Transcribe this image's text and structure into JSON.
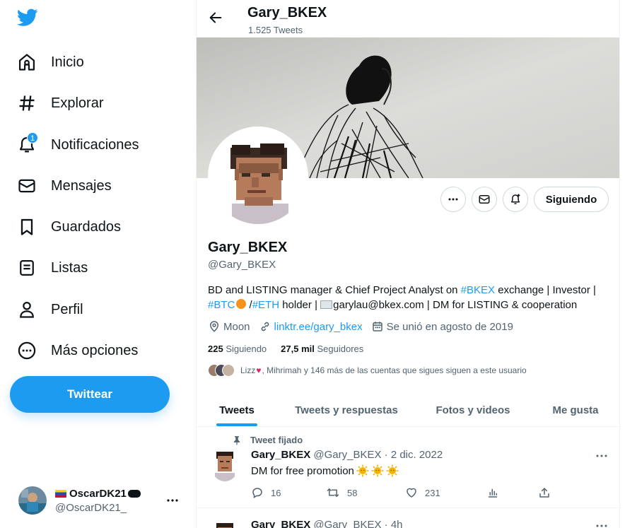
{
  "sidebar": {
    "items": [
      {
        "label": "Inicio",
        "icon": "home-icon"
      },
      {
        "label": "Explorar",
        "icon": "hashtag-icon"
      },
      {
        "label": "Notificaciones",
        "icon": "bell-icon",
        "badge": "1"
      },
      {
        "label": "Mensajes",
        "icon": "mail-icon"
      },
      {
        "label": "Guardados",
        "icon": "bookmark-icon"
      },
      {
        "label": "Listas",
        "icon": "list-icon"
      },
      {
        "label": "Perfil",
        "icon": "person-icon"
      },
      {
        "label": "Más opciones",
        "icon": "more-circle-icon"
      }
    ],
    "tweet_button": "Twittear",
    "account": {
      "name": "OscarDK21",
      "handle": "@OscarDK21_"
    }
  },
  "header": {
    "name": "Gary_BKEX",
    "tweet_count": "1.525 Tweets"
  },
  "profile": {
    "follow_button": "Siguiendo",
    "name": "Gary_BKEX",
    "handle": "@Gary_BKEX",
    "bio": {
      "p1": "BD and LISTING manager & Chief Project Analyst on ",
      "tag1": "#BKEX",
      "p2": " exchange | Investor | ",
      "tag2": "#BTC",
      "p3": " /",
      "tag3": "#ETH",
      "p4": " holder | ",
      "p5": "garylau@bkex.com | DM for LISTING & cooperation"
    },
    "location": "Moon",
    "website": "linktr.ee/gary_bkex",
    "joined": "Se unió en agosto de 2019",
    "following_count": "225",
    "following_label": "Siguiendo",
    "followers_count": "27,5 mil",
    "followers_label": "Seguidores",
    "followed_by_name": "Lizz",
    "followed_by_rest": ", Mihrimah y 146 más de las cuentas que sigues siguen a este usuario"
  },
  "tabs": [
    "Tweets",
    "Tweets y respuestas",
    "Fotos y videos",
    "Me gusta"
  ],
  "tweets": [
    {
      "pinned_label": "Tweet fijado",
      "name": "Gary_BKEX",
      "meta": "@Gary_BKEX · 2 dic. 2022",
      "text": "DM for free promotion",
      "replies": "16",
      "retweets": "58",
      "likes": "231"
    },
    {
      "name": "Gary_BKEX",
      "meta": "@Gary_BKEX · 4h"
    }
  ],
  "colors": {
    "accent": "#1d9bf0",
    "text": "#0f1419",
    "secondary": "#536471"
  }
}
